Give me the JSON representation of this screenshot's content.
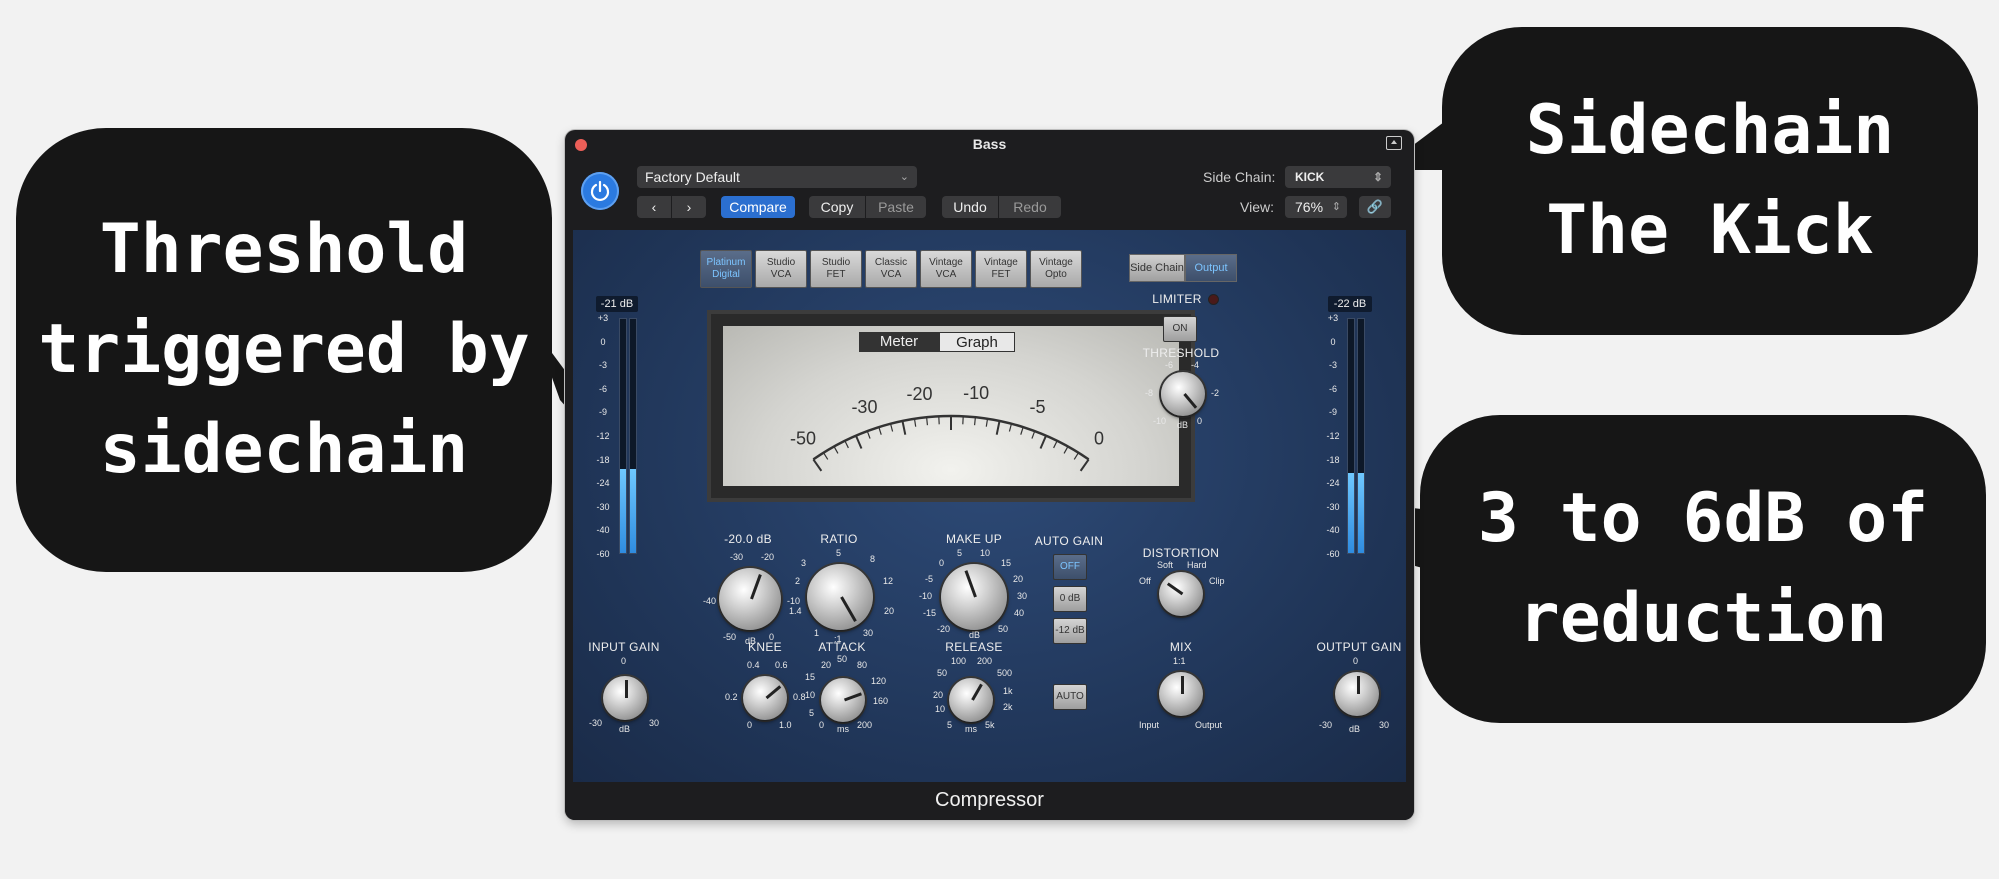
{
  "annotations": {
    "left": [
      "Threshold",
      "triggered by",
      "sidechain"
    ],
    "right_top": [
      "Sidechain",
      "The Kick"
    ],
    "right_bottom": [
      "3 to 6dB of",
      "reduction"
    ]
  },
  "window": {
    "title": "Bass",
    "footer": "Compressor"
  },
  "toolbar": {
    "preset": "Factory Default",
    "prev_icon": "chevron-left-icon",
    "next_icon": "chevron-right-icon",
    "compare": "Compare",
    "copy": "Copy",
    "paste": "Paste",
    "undo": "Undo",
    "redo": "Redo",
    "side_chain_label": "Side Chain:",
    "side_chain_value": "KICK",
    "view_label": "View:",
    "view_value": "76%"
  },
  "models": [
    {
      "line1": "Platinum",
      "line2": "Digital",
      "active": true
    },
    {
      "line1": "Studio",
      "line2": "VCA"
    },
    {
      "line1": "Studio",
      "line2": "FET"
    },
    {
      "line1": "Classic",
      "line2": "VCA"
    },
    {
      "line1": "Vintage",
      "line2": "VCA"
    },
    {
      "line1": "Vintage",
      "line2": "FET"
    },
    {
      "line1": "Vintage",
      "line2": "Opto"
    }
  ],
  "side_buttons": {
    "side_chain": "Side Chain",
    "output": "Output"
  },
  "meter": {
    "tab_meter": "Meter",
    "tab_graph": "Graph",
    "scale": [
      "-50",
      "-30",
      "-20",
      "-10",
      "-5",
      "0"
    ]
  },
  "input_meter": {
    "readout": "-21 dB",
    "scale": [
      "+3",
      "0",
      "-3",
      "-6",
      "-9",
      "-12",
      "-18",
      "-24",
      "-30",
      "-40",
      "-60"
    ],
    "level": 0.36
  },
  "output_meter": {
    "readout": "-22 dB",
    "scale": [
      "+3",
      "0",
      "-3",
      "-6",
      "-9",
      "-12",
      "-18",
      "-24",
      "-30",
      "-40",
      "-60"
    ],
    "level": 0.34
  },
  "threshold": {
    "readout": "-20.0 dB",
    "scale": [
      "-30",
      "-20",
      "-40",
      "-10",
      "-50",
      "dB",
      "0"
    ]
  },
  "ratio": {
    "label": "RATIO",
    "scale": [
      "5",
      "3",
      "8",
      "2",
      "12",
      "1.4",
      "20",
      "1",
      ":1",
      "30"
    ]
  },
  "makeup": {
    "label": "MAKE UP",
    "scale": [
      "5",
      "10",
      "0",
      "15",
      "-5",
      "20",
      "-10",
      "30",
      "-15",
      "40",
      "-20",
      "dB",
      "50"
    ]
  },
  "auto_gain": {
    "label": "AUTO GAIN",
    "off": "OFF",
    "zero": "0 dB",
    "minus12": "-12 dB"
  },
  "knee": {
    "label": "KNEE",
    "scale": [
      "0.4",
      "0.6",
      "0.2",
      "0.8",
      "0",
      "1.0"
    ]
  },
  "attack": {
    "label": "ATTACK",
    "scale": [
      "20",
      "50",
      "80",
      "15",
      "120",
      "10",
      "160",
      "5",
      "0",
      "ms",
      "200"
    ]
  },
  "release": {
    "label": "RELEASE",
    "scale": [
      "100",
      "200",
      "50",
      "500",
      "20",
      "1k",
      "10",
      "2k",
      "5",
      "ms",
      "5k"
    ]
  },
  "auto_release": "AUTO",
  "limiter": {
    "label": "LIMITER",
    "on": "ON",
    "threshold_label": "THRESHOLD",
    "scale": [
      "-6",
      "-4",
      "-8",
      "-2",
      "-10",
      "dB",
      "0"
    ]
  },
  "distortion": {
    "label": "DISTORTION",
    "soft": "Soft",
    "hard": "Hard",
    "off": "Off",
    "clip": "Clip"
  },
  "mix": {
    "label": "MIX",
    "ratio": "1:1",
    "input": "Input",
    "output": "Output"
  },
  "input_gain": {
    "label": "INPUT GAIN",
    "scale": [
      "0",
      "-30",
      "dB",
      "30"
    ]
  },
  "output_gain": {
    "label": "OUTPUT GAIN",
    "scale": [
      "0",
      "-30",
      "dB",
      "30"
    ]
  }
}
